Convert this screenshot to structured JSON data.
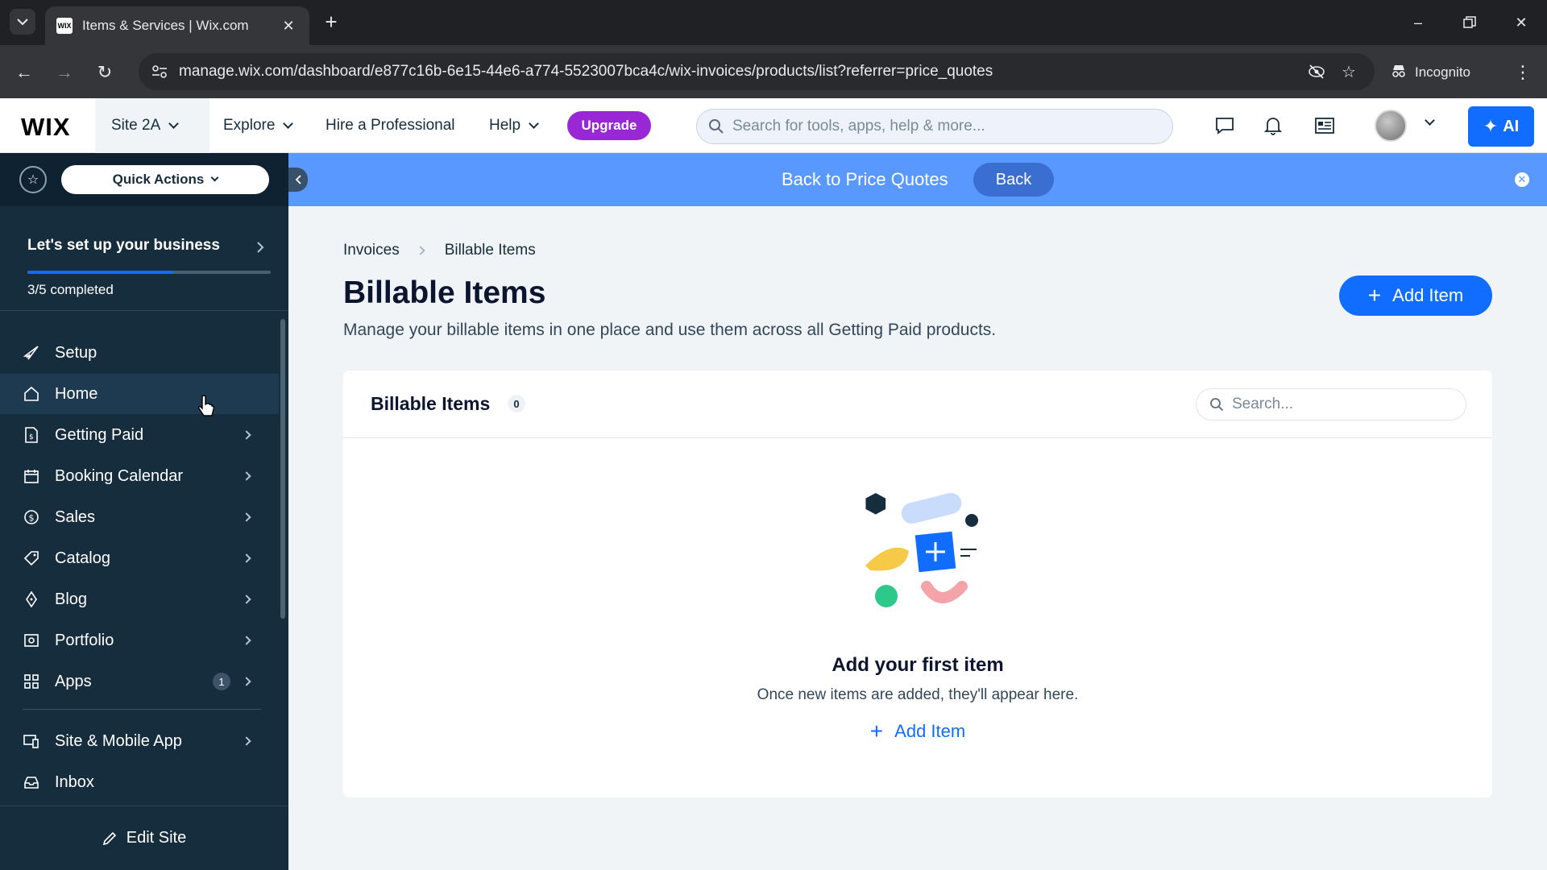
{
  "browser": {
    "tab_title": "Items & Services | Wix.com",
    "favicon_text": "WIX",
    "url": "manage.wix.com/dashboard/e877c16b-6e15-44e6-a774-5523007bca4c/wix-invoices/products/list?referrer=price_quotes",
    "incognito_label": "Incognito"
  },
  "topbar": {
    "logo": "WIX",
    "site_name": "Site 2A",
    "explore": "Explore",
    "hire": "Hire a Professional",
    "help": "Help",
    "upgrade": "Upgrade",
    "search_placeholder": "Search for tools, apps, help & more...",
    "ai_label": "AI"
  },
  "sidebar": {
    "quick_actions": "Quick Actions",
    "setup_title": "Let's set up your business",
    "setup_progress": 0.6,
    "setup_count": "3/5 completed",
    "items": [
      {
        "label": "Setup",
        "icon": "rocket-icon"
      },
      {
        "label": "Home",
        "icon": "home-icon"
      },
      {
        "label": "Getting Paid",
        "icon": "invoice-icon"
      },
      {
        "label": "Booking Calendar",
        "icon": "calendar-icon"
      },
      {
        "label": "Sales",
        "icon": "dollar-icon"
      },
      {
        "label": "Catalog",
        "icon": "tag-icon"
      },
      {
        "label": "Blog",
        "icon": "pen-icon"
      },
      {
        "label": "Portfolio",
        "icon": "portfolio-icon"
      },
      {
        "label": "Apps",
        "icon": "apps-icon",
        "badge": "1"
      },
      {
        "label": "Site & Mobile App",
        "icon": "devices-icon"
      },
      {
        "label": "Inbox",
        "icon": "inbox-icon"
      }
    ],
    "edit_site": "Edit Site"
  },
  "banner": {
    "text": "Back to Price Quotes",
    "back_label": "Back"
  },
  "main": {
    "breadcrumb": [
      "Invoices",
      "Billable Items"
    ],
    "title": "Billable Items",
    "subtitle": "Manage your billable items in one place and use them across all Getting Paid products.",
    "add_button": "Add Item",
    "card": {
      "title": "Billable Items",
      "count": "0",
      "search_placeholder": "Search...",
      "empty_title": "Add your first item",
      "empty_subtitle": "Once new items are added, they'll appear here.",
      "empty_add": "Add Item"
    }
  },
  "colors": {
    "accent": "#116dff",
    "upgrade": "#9a27d5",
    "sidebar": "#162d3d",
    "banner": "#5999ff"
  }
}
